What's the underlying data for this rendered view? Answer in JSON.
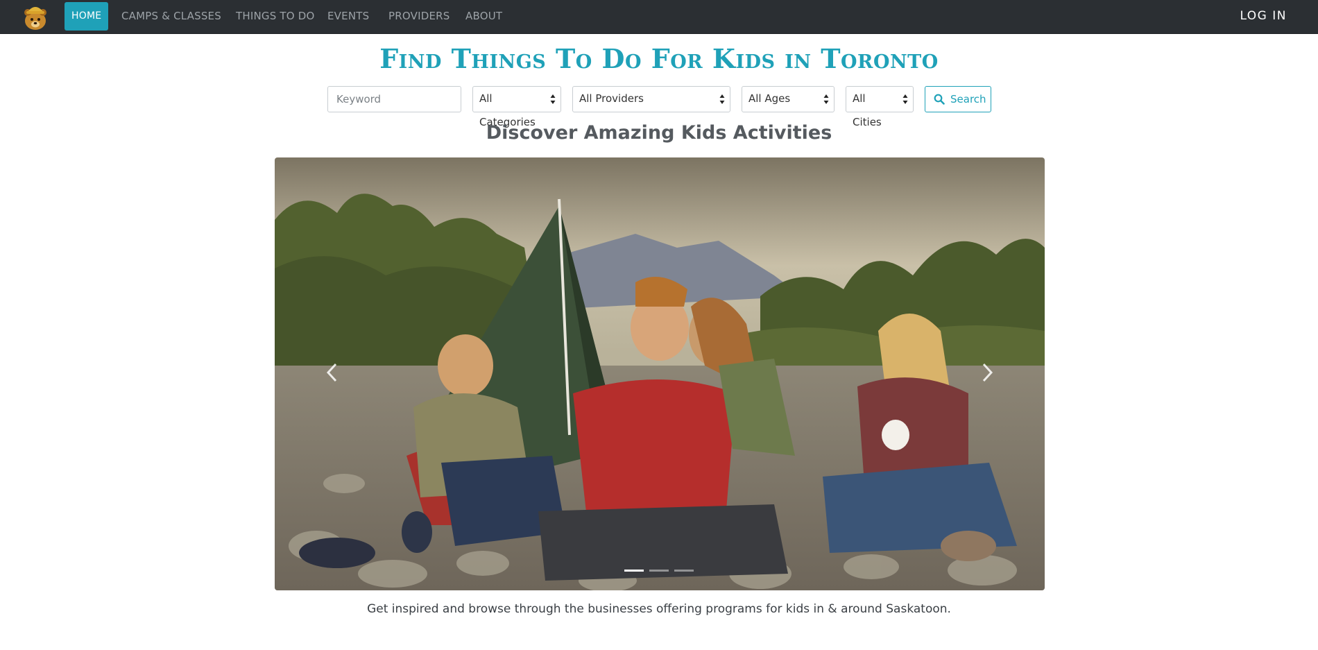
{
  "navbar": {
    "items": [
      {
        "label": "HOME",
        "active": true
      },
      {
        "label": "CAMPS & CLASSES",
        "active": false
      },
      {
        "label": "THINGS TO DO",
        "active": false
      },
      {
        "label": "EVENTS",
        "active": false
      },
      {
        "label": "PROVIDERS",
        "active": false
      },
      {
        "label": "ABOUT",
        "active": false
      }
    ],
    "login_label": "LOG IN",
    "logo_icon": "bear-mascot-icon"
  },
  "hero": {
    "title": "Find Things To Do For Kids in Toronto",
    "subtitle": "Discover Amazing Kids Activities"
  },
  "search": {
    "keyword_placeholder": "Keyword",
    "category_value": "All Categories",
    "provider_value": "All Providers",
    "age_value": "All Ages",
    "city_value": "All Cities",
    "button_label": "Search",
    "button_icon": "search-icon"
  },
  "carousel": {
    "slide_count": 3,
    "active_slide": 1,
    "prev_icon": "chevron-left-icon",
    "next_icon": "chevron-right-icon"
  },
  "caption": "Get inspired and browse through the businesses offering programs for kids in & around Saskatoon.",
  "colors": {
    "accent": "#1fa1b8",
    "navbar_bg": "#2b2f33"
  }
}
